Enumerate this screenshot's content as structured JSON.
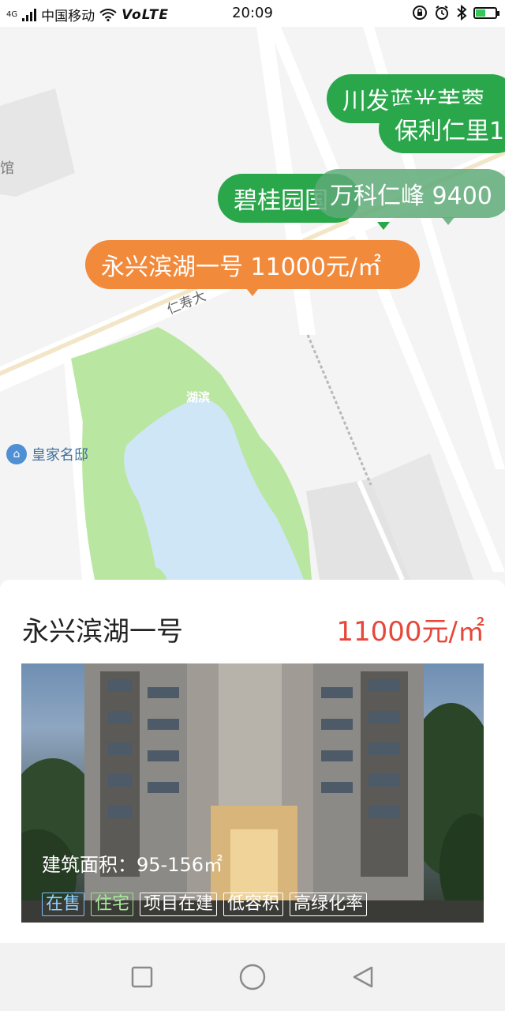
{
  "status_bar": {
    "network_type": "4G",
    "carrier": "中国移动",
    "volte": "VoLTE",
    "time": "20:09",
    "icons": [
      "lock-rotation-icon",
      "alarm-icon",
      "bluetooth-icon",
      "battery-charging-icon"
    ]
  },
  "map": {
    "labels": {
      "building_partial": "馆",
      "road": "仁寿大",
      "lake": "湖滨",
      "poi": "皇家名邸"
    },
    "bubbles": [
      {
        "text": "川发蓝光芙蓉",
        "style": "green"
      },
      {
        "text": "保利仁里1",
        "style": "green"
      },
      {
        "text": "碧桂园国",
        "style": "green"
      },
      {
        "text": "万科仁峰 9400",
        "style": "faded"
      },
      {
        "text": "永兴滨湖一号 11000元/㎡",
        "style": "orange"
      }
    ],
    "colors": {
      "green": "#2aa64b",
      "orange": "#f28a3c",
      "park": "#b9e6a1",
      "water": "#cfe6f7"
    }
  },
  "card": {
    "name": "永兴滨湖一号",
    "price": "11000元/㎡",
    "area": "建筑面积：95-156㎡",
    "tags": [
      {
        "label": "在售",
        "color": "blue"
      },
      {
        "label": "住宅",
        "color": "green"
      },
      {
        "label": "项目在建",
        "color": "white"
      },
      {
        "label": "低容积",
        "color": "white"
      },
      {
        "label": "高绿化率",
        "color": "white"
      }
    ]
  },
  "nav_bar": {
    "buttons": [
      "recents-square-icon",
      "home-circle-icon",
      "back-triangle-icon"
    ]
  }
}
